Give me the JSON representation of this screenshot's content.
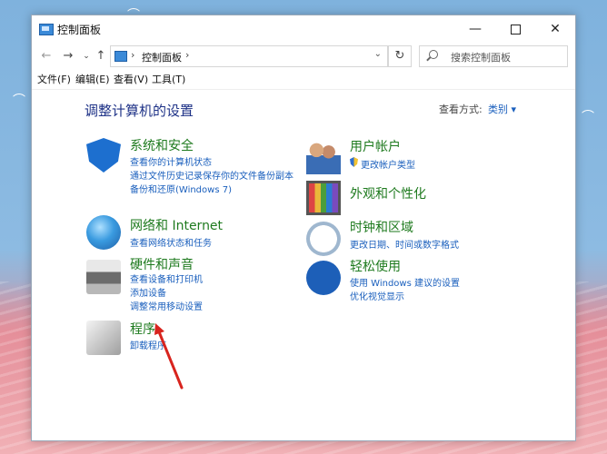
{
  "window": {
    "title": "控制面板",
    "controls": {
      "minimize": "—",
      "maximize": "□",
      "close": "✕"
    }
  },
  "address": {
    "back": "←",
    "forward": "→",
    "dropdown": "⌄",
    "up": "↑",
    "separator": "›",
    "path": "控制面板",
    "chevron": "⌄",
    "refresh": "↻",
    "search_placeholder": "搜索控制面板"
  },
  "menu": [
    "文件(F)",
    "编辑(E)",
    "查看(V)",
    "工具(T)"
  ],
  "main": {
    "heading": "调整计算机的设置",
    "view_by_label": "查看方式:",
    "view_by_value": "类别 ▾"
  },
  "categories_left": [
    {
      "icon": "shield-icon",
      "title": "系统和安全",
      "links": [
        "查看你的计算机状态",
        "通过文件历史记录保存你的文件备份副本",
        "备份和还原(Windows 7)"
      ]
    },
    {
      "icon": "network-globe-icon",
      "title": "网络和 Internet",
      "links": [
        "查看网络状态和任务"
      ]
    },
    {
      "icon": "printer-icon",
      "title": "硬件和声音",
      "links": [
        "查看设备和打印机",
        "添加设备",
        "调整常用移动设置"
      ]
    },
    {
      "icon": "programs-box-icon",
      "title": "程序",
      "links": [
        "卸载程序"
      ]
    }
  ],
  "categories_right": [
    {
      "icon": "users-icon",
      "title": "用户帐户",
      "links": [
        "更改帐户类型"
      ]
    },
    {
      "icon": "monitor-icon",
      "title": "外观和个性化",
      "links": []
    },
    {
      "icon": "clock-globe-icon",
      "title": "时钟和区域",
      "links": [
        "更改日期、时间或数字格式"
      ]
    },
    {
      "icon": "ease-of-access-icon",
      "title": "轻松使用",
      "links": [
        "使用 Windows 建议的设置",
        "优化视觉显示"
      ]
    }
  ],
  "colors": {
    "heading": "#1e3287",
    "category_title": "#1e7a1e",
    "link": "#1a5fbd",
    "annotation_arrow": "#d8241e"
  }
}
